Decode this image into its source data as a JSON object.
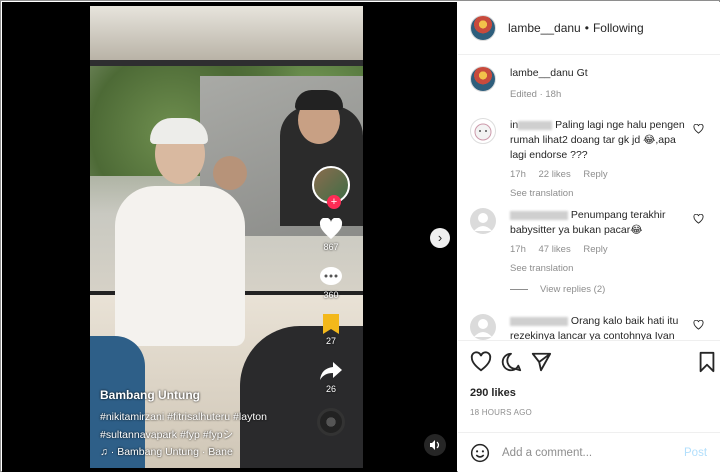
{
  "video": {
    "author": "Bambang Untung",
    "tags_line1": "#nikitamirzani #fitrisalhuteru #layton",
    "tags_line2": "#sultannavapark #fyp #fypシ",
    "music": "♫ · Bambang Untung · Bane",
    "likes_count": "867",
    "comments_count": "360",
    "bookmarks_count": "27",
    "shares_count": "26"
  },
  "header": {
    "username": "lambe__danu",
    "dot": "•",
    "follow_status": "Following"
  },
  "caption": {
    "username": "lambe__danu",
    "text": "Gt",
    "meta": "Edited · 18h"
  },
  "comments": [
    {
      "username_visible": "in",
      "text": "Paling lagi nge halu pengen rumah lihat2 doang tar gk jd 😂,apa lagi endorse ???",
      "time": "17h",
      "likes": "22 likes",
      "reply": "Reply",
      "see_translation": "See translation"
    },
    {
      "username_visible": "",
      "text": "Penumpang terakhir babysitter ya bukan pacar😂",
      "time": "17h",
      "likes": "47 likes",
      "reply": "Reply",
      "see_translation": "See translation",
      "view_replies": "View replies (2)"
    },
    {
      "username_visible": "",
      "text": "Orang kalo baik hati itu rezekinya lancar ya contohnya Ivan"
    }
  ],
  "post": {
    "likes": "290 likes",
    "time_ago": "18 HOURS AGO"
  },
  "add_comment": {
    "placeholder": "Add a comment...",
    "post_label": "Post"
  },
  "icons": [
    "heart-icon",
    "comment-icon",
    "share-icon",
    "save-icon",
    "emoji-icon",
    "chevron-right-icon",
    "volume-icon"
  ]
}
